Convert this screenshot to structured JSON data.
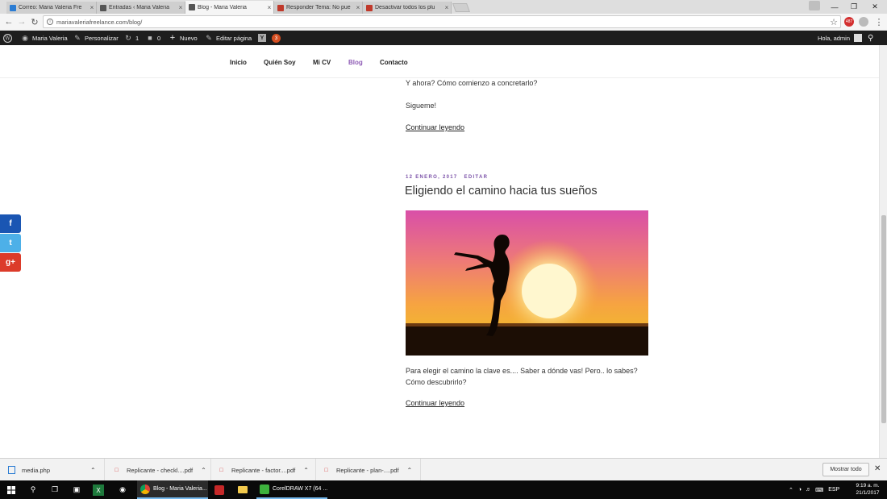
{
  "browser": {
    "tabs": [
      {
        "title": "Correo: Maria Valeria Fre",
        "color": "#2b7cd3"
      },
      {
        "title": "Entradas ‹ Maria Valeria",
        "color": "#555555"
      },
      {
        "title": "Blog - Maria Valeria",
        "color": "#555555",
        "active": true
      },
      {
        "title": "Responder Tema: No pue",
        "color": "#c0392b"
      },
      {
        "title": "Desactivar todos los plu",
        "color": "#c0392b"
      }
    ],
    "close_glyph": "×",
    "url": "mariavaleriafreelance.com/blog/",
    "extension_badge": "487"
  },
  "adminbar": {
    "site_name": "Maria Valeria",
    "customize": "Personalizar",
    "updates": "1",
    "comments": "0",
    "new": "Nuevo",
    "edit_page": "Editar página",
    "yoast_count": "3",
    "greeting": "Hola, admin"
  },
  "nav": {
    "items": [
      "Inicio",
      "Quién Soy",
      "Mi CV",
      "Blog",
      "Contacto"
    ]
  },
  "posts": {
    "prev_line1": "Y ahora? Cómo comienzo a concretarlo?",
    "prev_line2": "Sigueme!",
    "prev_readmore": "Continuar leyendo",
    "date": "12 ENERO, 2017",
    "edit": "EDITAR",
    "title": "Eligiendo el camino hacia tus sueños",
    "excerpt_line1": "Para elegir el camino la clave es.... Saber a dónde vas! Pero.. lo sabes?",
    "excerpt_line2": "Cómo descubrirlo?",
    "readmore": "Continuar leyendo"
  },
  "share": {
    "facebook": "f",
    "twitter": "t",
    "googleplus": "g+"
  },
  "downloads": {
    "items": [
      "media.php",
      "Replicante - checkl....pdf",
      "Replicante - factor....pdf",
      "Replicante - plan-....pdf"
    ],
    "show_all": "Mostrar todo"
  },
  "taskbar": {
    "chrome_app": "Blog - Maria Valeria...",
    "corel_app": "CorelDRAW X7 (64 ...",
    "language": "ESP",
    "time": "9:19 a. m.",
    "date": "21/1/2017"
  }
}
